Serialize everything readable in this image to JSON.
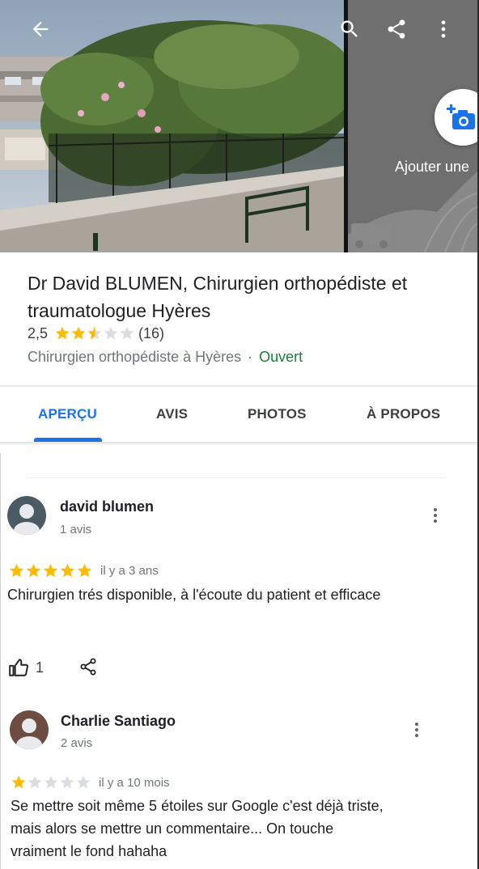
{
  "header": {
    "back_icon": "arrow-back-icon",
    "search_icon": "search-icon",
    "share_icon": "share-icon",
    "more_icon": "more-vert-icon",
    "add_photo_icon": "add-photo-camera-icon",
    "add_photo_label": "Ajouter une"
  },
  "place": {
    "title": "Dr David BLUMEN, Chirurgien orthopédiste et traumatologue Hyères",
    "rating_value": "2,5",
    "rating_stars": 2.5,
    "review_count": "(16)",
    "category": "Chirurgien orthopédiste à Hyères",
    "separator": "·",
    "status": "Ouvert"
  },
  "tabs": [
    {
      "label": "APERÇU",
      "selected": true
    },
    {
      "label": "AVIS",
      "selected": false
    },
    {
      "label": "PHOTOS",
      "selected": false
    },
    {
      "label": "À PROPOS",
      "selected": false
    }
  ],
  "reviews": [
    {
      "author": "david blumen",
      "author_meta": "1 avis",
      "stars": 5,
      "time": "il y a 3 ans",
      "text": "Chirurgien trés disponible, à l'écoute du patient et efficace",
      "likes": "1"
    },
    {
      "author": "Charlie Santiago",
      "author_meta": "2 avis",
      "stars": 1,
      "time": "il y a 10 mois",
      "text": "Se mettre soit même 5 étoiles sur Google c'est déjà triste, mais alors se mettre un commentaire... On touche vraiment le fond hahaha"
    }
  ],
  "colors": {
    "accent": "#1a73e8",
    "star": "#fbbc04",
    "star_empty": "#dadce0",
    "open": "#188038",
    "secondary_text": "#70757a"
  }
}
